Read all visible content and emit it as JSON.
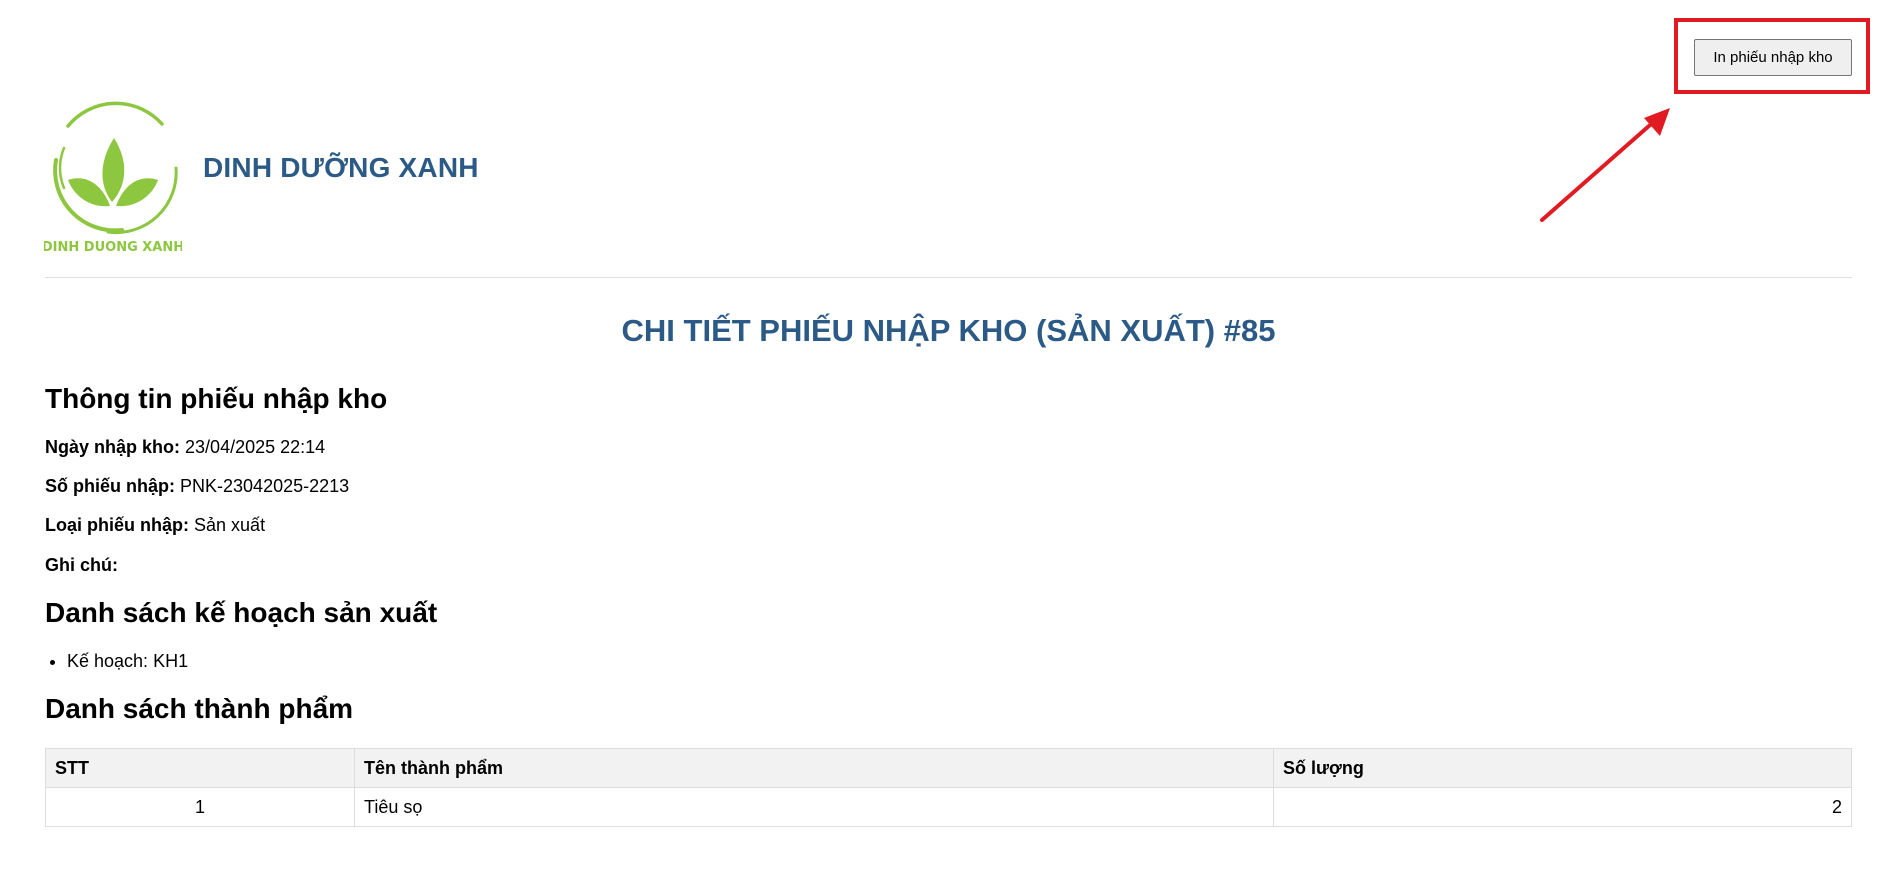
{
  "header": {
    "print_button_label": "In phiếu nhập kho",
    "brand_name": "DINH DƯỠNG XANH",
    "logo_text": "DINH DUONG XANH",
    "brand_color": "#2c5a86",
    "logo_color": "#8dc63f",
    "highlight_color": "#e11b22"
  },
  "page_title": "CHI TIẾT PHIẾU NHẬP KHO (SẢN XUẤT) #85",
  "info": {
    "heading": "Thông tin phiếu nhập kho",
    "date_label": "Ngày nhập kho:",
    "date_value": "23/04/2025 22:14",
    "receipt_no_label": "Số phiếu nhập:",
    "receipt_no_value": "PNK-23042025-2213",
    "type_label": "Loại phiếu nhập:",
    "type_value": "Sản xuất",
    "note_label": "Ghi chú:",
    "note_value": ""
  },
  "plans": {
    "heading": "Danh sách kế hoạch sản xuất",
    "items": [
      {
        "label": "Kế hoạch: KH1"
      }
    ]
  },
  "products": {
    "heading": "Danh sách thành phẩm",
    "columns": [
      "STT",
      "Tên thành phẩm",
      "Số lượng"
    ],
    "rows": [
      {
        "stt": "1",
        "name": "Tiêu sọ",
        "quantity": "2"
      }
    ]
  }
}
